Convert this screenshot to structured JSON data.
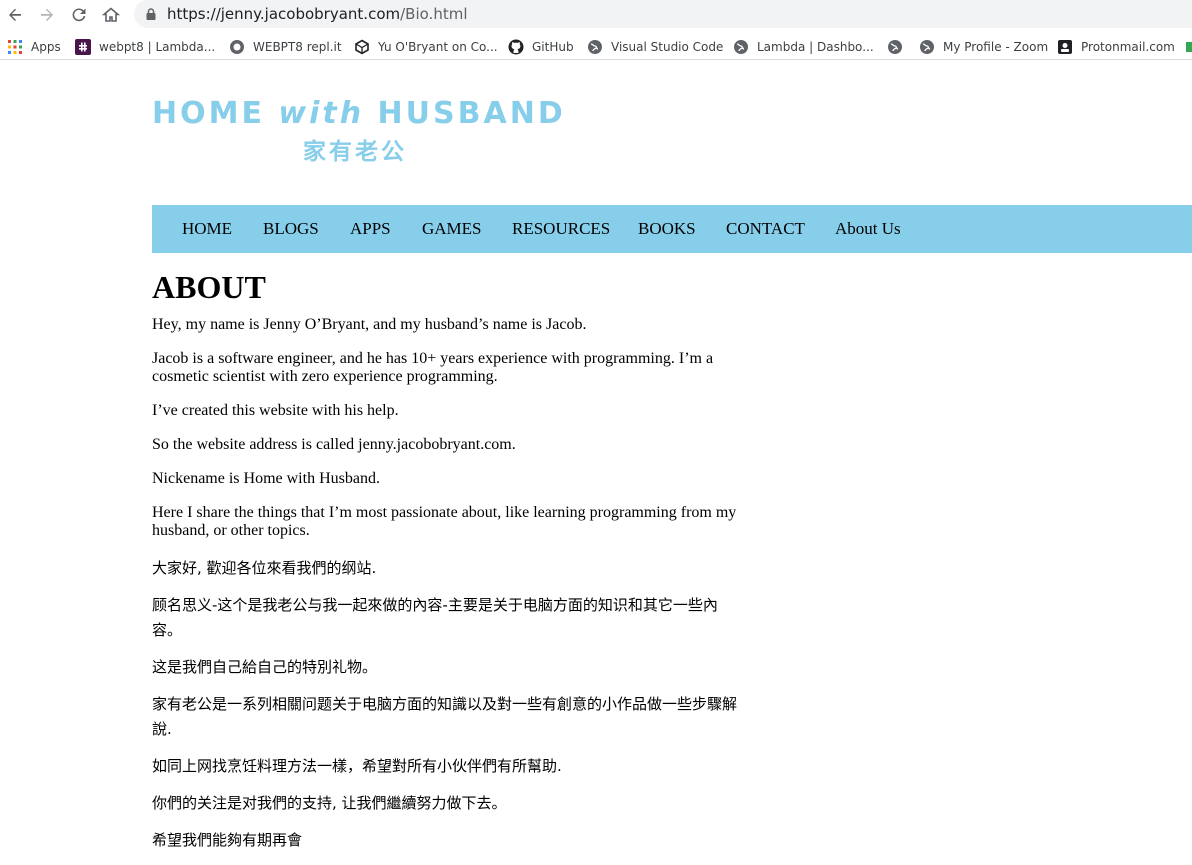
{
  "browser": {
    "url_host": "https://jenny.jacobobryant.com",
    "url_path": "/Bio.html",
    "bookmarks": [
      {
        "label": "Apps",
        "icon": "apps-grid-icon"
      },
      {
        "label": "webpt8 | Lambda...",
        "icon": "slack-icon"
      },
      {
        "label": "WEBPT8 repl.it",
        "icon": "replit-icon"
      },
      {
        "label": "Yu O'Bryant on Co...",
        "icon": "codesandbox-icon"
      },
      {
        "label": "GitHub",
        "icon": "github-icon"
      },
      {
        "label": "Visual Studio Code",
        "icon": "globe-icon"
      },
      {
        "label": "Lambda | Dashbo...",
        "icon": "globe-icon"
      },
      {
        "label": "",
        "icon": "globe-icon"
      },
      {
        "label": "My Profile - Zoom",
        "icon": "globe-icon"
      },
      {
        "label": "Protonmail.com",
        "icon": "protonmail-icon"
      }
    ]
  },
  "site": {
    "title_part1": "HOME ",
    "title_part2": "with",
    "title_part3": " HUSBAND",
    "subtitle": "家有老公",
    "accent_color": "#87ceeb"
  },
  "nav": {
    "items": [
      {
        "label": "HOME"
      },
      {
        "label": "BLOGS"
      },
      {
        "label": "APPS"
      },
      {
        "label": "GAMES"
      },
      {
        "label": "RESOURCES"
      },
      {
        "label": "BOOKS"
      },
      {
        "label": "CONTACT"
      },
      {
        "label": "About Us"
      }
    ]
  },
  "about": {
    "heading": "ABOUT",
    "paragraphs": [
      "Hey, my name is Jenny O’Bryant, and my husband’s name is Jacob.",
      "Jacob is a software engineer, and he has 10+ years experience with programming. I’m a cosmetic scientist with zero experience programming.",
      "I’ve created this website with his help.",
      "So the website address is called jenny.jacobobryant.com.",
      "Nickename is Home with Husband.",
      "Here I share the things that I’m most passionate about, like learning programming from my husband, or other topics."
    ],
    "zh_paragraphs": [
      "大家好, 歡迎各位來看我們的纲站.",
      "顾名思义-这个是我老公与我一起來做的內容-主要是关于电脑方面的知识和其它一些內容。",
      "这是我們自己給自己的特別礼物。",
      "家有老公是一系列相關问题关于电脑方面的知識以及對一些有創意的小作品做一些步驟解說.",
      "如同上网找烹饪料理方法一樣，希望對所有小伙伴們有所幫助.",
      "你們的关注是对我們的支持, 让我們繼續努力做下去。",
      "希望我們能夠有期再會"
    ]
  }
}
